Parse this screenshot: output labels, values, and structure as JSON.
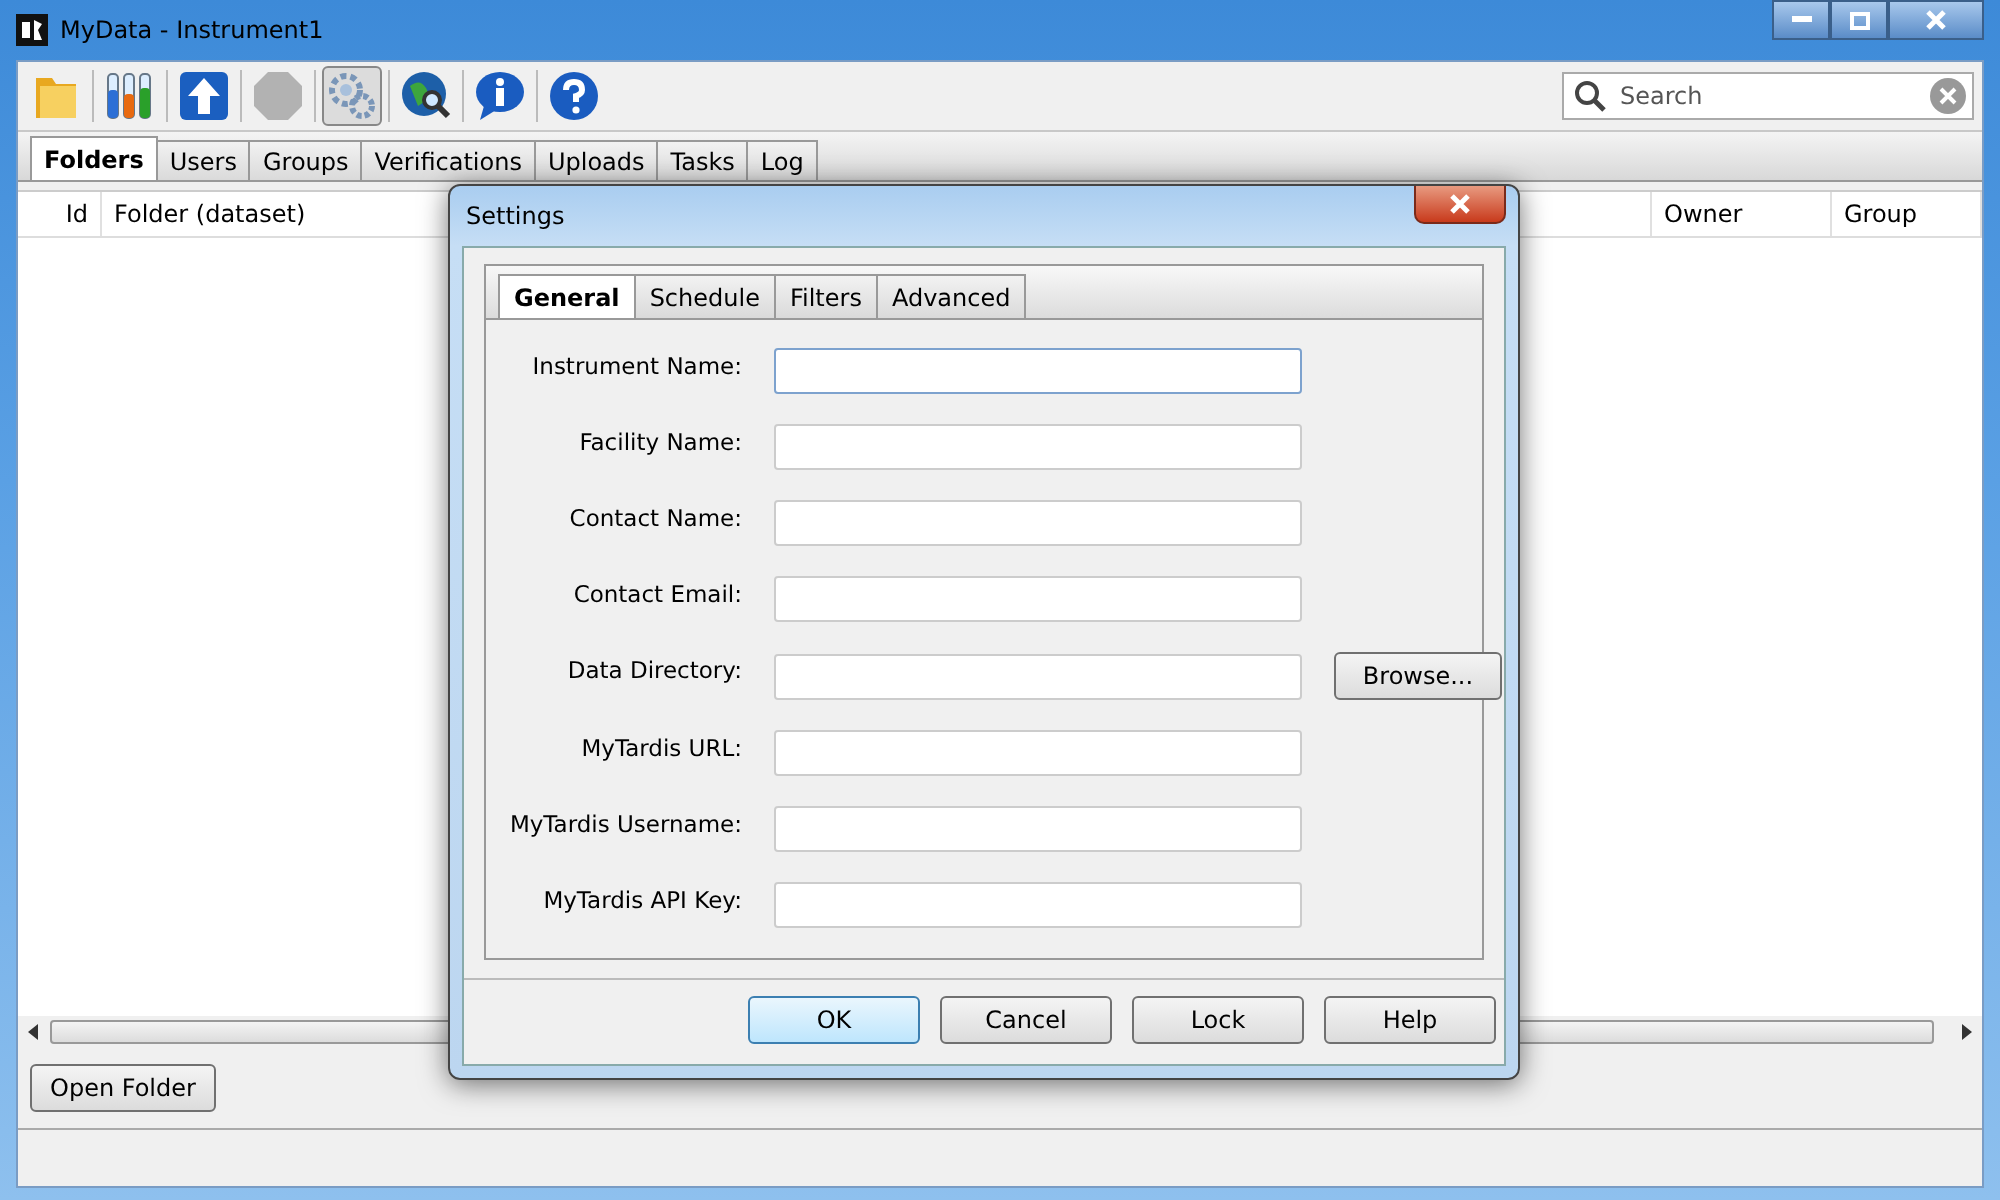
{
  "window": {
    "title": "MyData - Instrument1"
  },
  "toolbar": [
    {
      "kind": "folder",
      "selected": false,
      "disabled": false
    },
    {
      "kind": "tubes",
      "selected": false,
      "disabled": false
    },
    {
      "kind": "upload",
      "selected": false,
      "disabled": false
    },
    {
      "kind": "stop",
      "selected": false,
      "disabled": true
    },
    {
      "kind": "gears",
      "selected": true,
      "disabled": false
    },
    {
      "kind": "globe",
      "selected": false,
      "disabled": false
    },
    {
      "kind": "info",
      "selected": false,
      "disabled": false
    },
    {
      "kind": "help",
      "selected": false,
      "disabled": false
    }
  ],
  "search": {
    "placeholder": "Search"
  },
  "tabs": [
    {
      "label": "Folders",
      "selected": true
    },
    {
      "label": "Users",
      "selected": false
    },
    {
      "label": "Groups",
      "selected": false
    },
    {
      "label": "Verifications",
      "selected": false
    },
    {
      "label": "Uploads",
      "selected": false
    },
    {
      "label": "Tasks",
      "selected": false
    },
    {
      "label": "Log",
      "selected": false
    }
  ],
  "table": {
    "columns": [
      "Id",
      "Folder (dataset)",
      "Owner",
      "Group"
    ]
  },
  "open_folder_button": "Open Folder",
  "dialog": {
    "title": "Settings",
    "tabs": [
      {
        "label": "General",
        "selected": true
      },
      {
        "label": "Schedule",
        "selected": false
      },
      {
        "label": "Filters",
        "selected": false
      },
      {
        "label": "Advanced",
        "selected": false
      }
    ],
    "fields": [
      {
        "label": "Instrument Name:",
        "focused": true
      },
      {
        "label": "Facility Name:",
        "focused": false
      },
      {
        "label": "Contact Name:",
        "focused": false
      },
      {
        "label": "Contact Email:",
        "focused": false
      },
      {
        "label": "Data Directory:",
        "focused": false,
        "button": "Browse..."
      },
      {
        "label": "MyTardis URL:",
        "focused": false
      },
      {
        "label": "MyTardis Username:",
        "focused": false
      },
      {
        "label": "MyTardis API Key:",
        "focused": false
      }
    ],
    "buttons": [
      {
        "label": "OK",
        "default": true
      },
      {
        "label": "Cancel",
        "default": false
      },
      {
        "label": "Lock",
        "default": false
      },
      {
        "label": "Help",
        "default": false
      }
    ]
  }
}
